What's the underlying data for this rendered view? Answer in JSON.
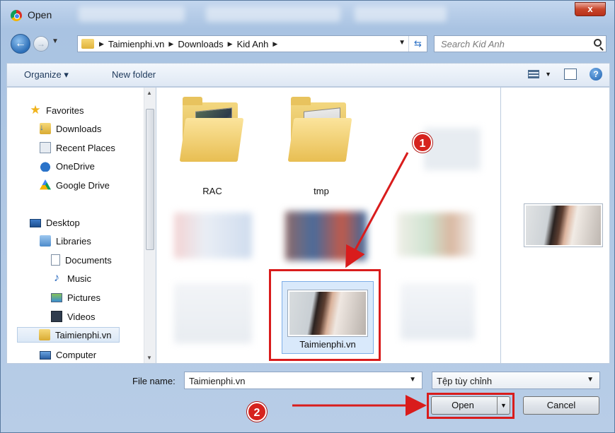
{
  "window": {
    "title": "Open",
    "close_label": "x"
  },
  "address": {
    "crumbs": [
      "Taimienphi.vn",
      "Downloads",
      "Kid Anh"
    ],
    "search_placeholder": "Search Kid Anh"
  },
  "toolbar": {
    "organize": "Organize ▾",
    "new_folder": "New folder"
  },
  "sidebar": {
    "favorites": "Favorites",
    "downloads": "Downloads",
    "recent": "Recent Places",
    "onedrive": "OneDrive",
    "gdrive": "Google Drive",
    "desktop": "Desktop",
    "libraries": "Libraries",
    "documents": "Documents",
    "music": "Music",
    "pictures": "Pictures",
    "videos": "Videos",
    "taimienphi": "Taimienphi.vn",
    "computer": "Computer"
  },
  "files": {
    "folder1": "RAC",
    "folder2": "tmp",
    "selected": "Taimienphi.vn"
  },
  "bottom": {
    "file_name_label": "File name:",
    "file_name_value": "Taimienphi.vn",
    "file_type": "Tệp tùy chỉnh",
    "open": "Open",
    "cancel": "Cancel"
  },
  "annotations": {
    "step1": "1",
    "step2": "2",
    "color": "#d91c1c"
  }
}
